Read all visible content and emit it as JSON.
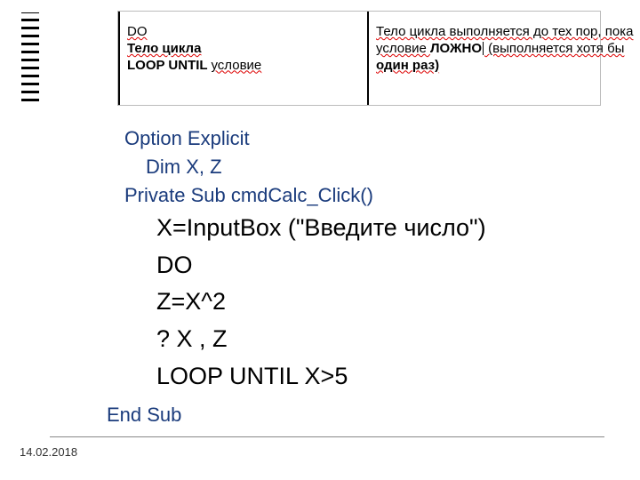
{
  "definition": {
    "left": {
      "l1": "DO",
      "l2": "Тело цикла",
      "l3_bold": "LOOP UNTIL",
      "l3_rest": "условие"
    },
    "right": {
      "l1": "Тело цикла выполняется до тех пор, пока",
      "l2_pre": "условие ",
      "l2_bold": "ЛОЖНО",
      "l2_post": " (выполняется хотя бы",
      "l3": "один раз)"
    }
  },
  "code": {
    "l1": "Option Explicit",
    "l2": "Dim X, Z",
    "l3": "Private Sub cmdCalc_Click()",
    "body": {
      "b1": "X=InputBox (\"Введите число\")",
      "b2": "DO",
      "b3": "Z=X^2",
      "b4": "? X , Z",
      "b5": "LOOP UNTIL X>5"
    },
    "end": "End Sub"
  },
  "footer": {
    "date": "14.02.2018"
  }
}
